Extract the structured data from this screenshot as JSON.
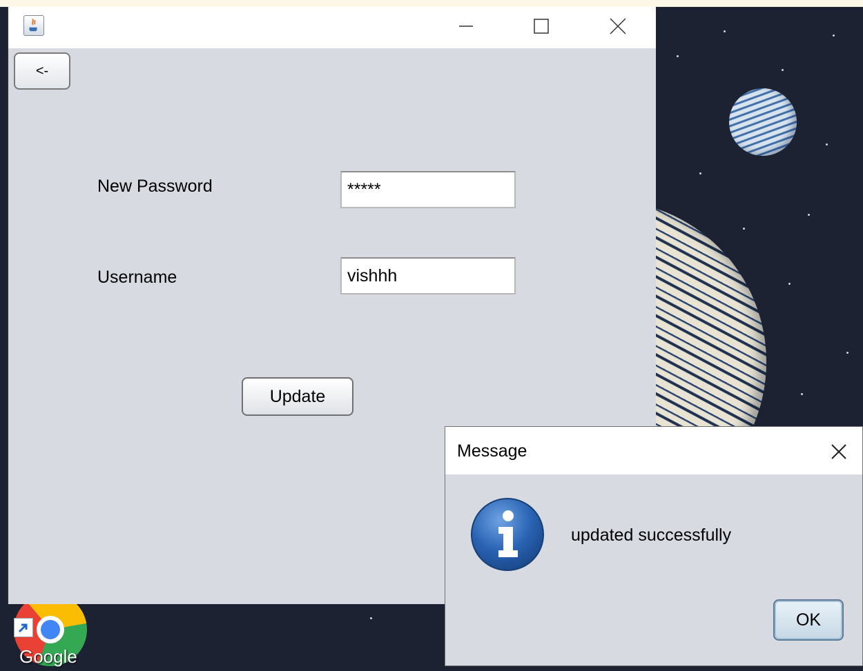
{
  "main_window": {
    "back_label": "<-",
    "fields": [
      {
        "label": "New Password",
        "value": "*****"
      },
      {
        "label": "Username",
        "value": "vishhh"
      }
    ],
    "update_label": "Update"
  },
  "dialog": {
    "title": "Message",
    "message": "updated successfully",
    "ok_label": "OK",
    "icon": "info-icon"
  },
  "desktop": {
    "shortcut_label": "Google",
    "shortcut_icon": "chrome-icon"
  },
  "colors": {
    "window_bg": "#d7dae1",
    "titlebar_bg": "#ffffff",
    "info_blue": "#2a64b4",
    "desktop_bg": "#1d2233"
  }
}
